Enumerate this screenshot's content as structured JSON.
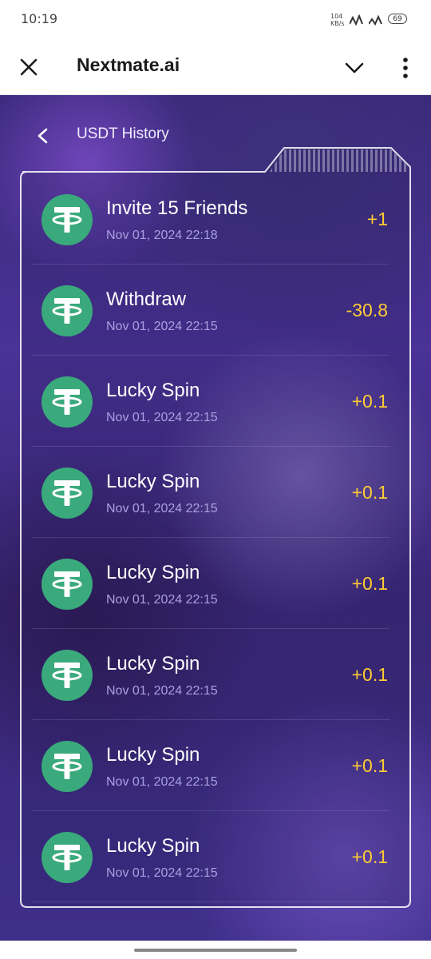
{
  "status_bar": {
    "time": "10:19",
    "network_speed": "104 KB/s",
    "network_type": "4G",
    "battery": "69"
  },
  "app_bar": {
    "title": "Nextmate.ai",
    "close_icon": "close-icon",
    "expand_icon": "chevron-down-icon",
    "more_icon": "more-vert-icon"
  },
  "page": {
    "title": "USDT History",
    "back_icon": "chevron-left-icon"
  },
  "colors": {
    "accent_amount": "#ffcc33",
    "coin": "#3aa97c",
    "background": "#4a3296"
  },
  "history": [
    {
      "label": "Invite 15 Friends",
      "date": "Nov 01, 2024 22:18",
      "amount": "+1"
    },
    {
      "label": "Withdraw",
      "date": "Nov 01, 2024 22:15",
      "amount": "-30.8"
    },
    {
      "label": "Lucky Spin",
      "date": "Nov 01, 2024 22:15",
      "amount": "+0.1"
    },
    {
      "label": "Lucky Spin",
      "date": "Nov 01, 2024 22:15",
      "amount": "+0.1"
    },
    {
      "label": "Lucky Spin",
      "date": "Nov 01, 2024 22:15",
      "amount": "+0.1"
    },
    {
      "label": "Lucky Spin",
      "date": "Nov 01, 2024 22:15",
      "amount": "+0.1"
    },
    {
      "label": "Lucky Spin",
      "date": "Nov 01, 2024 22:15",
      "amount": "+0.1"
    },
    {
      "label": "Lucky Spin",
      "date": "Nov 01, 2024 22:15",
      "amount": "+0.1"
    }
  ]
}
